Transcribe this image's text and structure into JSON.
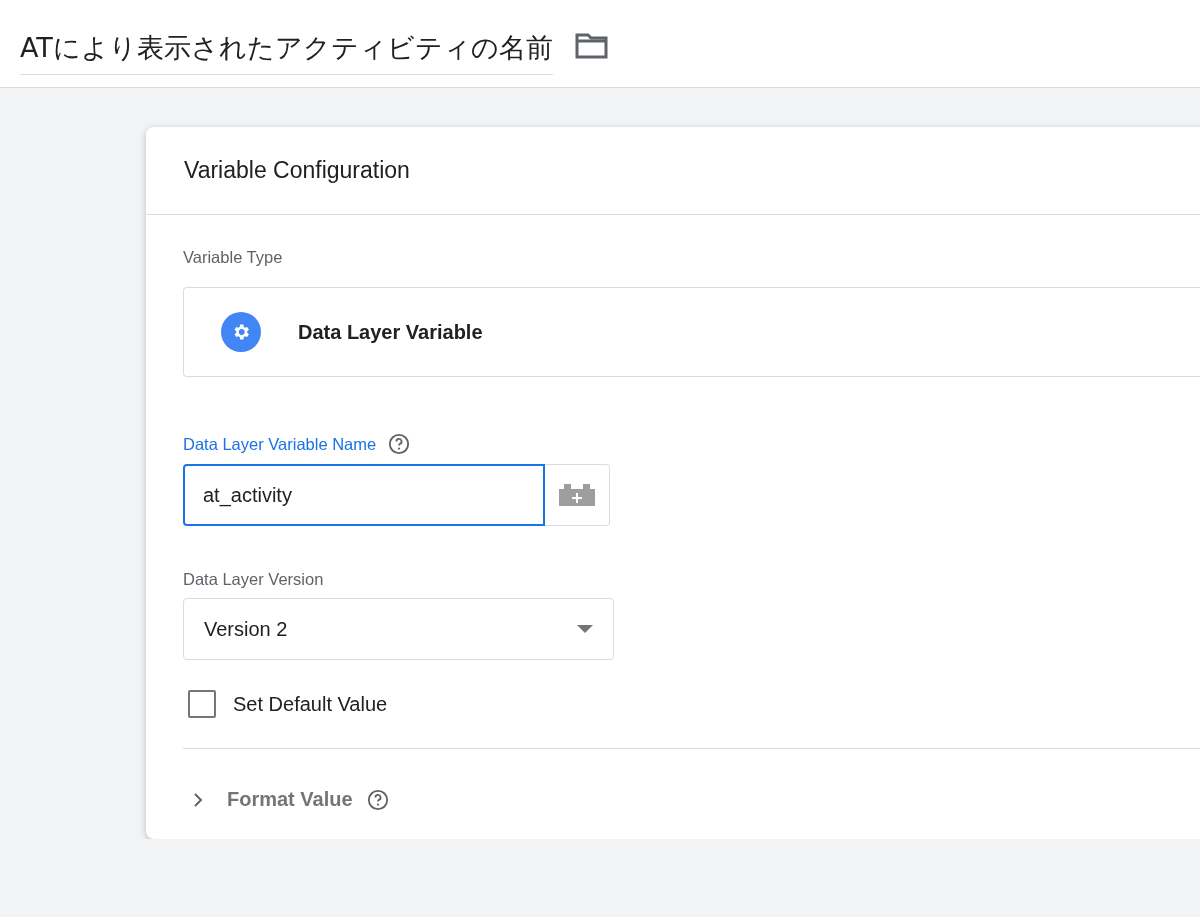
{
  "header": {
    "title": "ATにより表示されたアクティビティの名前"
  },
  "card": {
    "title": "Variable Configuration",
    "variable_type": {
      "label": "Variable Type",
      "name": "Data Layer Variable"
    },
    "name_field": {
      "label": "Data Layer Variable Name",
      "value": "at_activity",
      "focused": true
    },
    "version_select": {
      "label": "Data Layer Version",
      "value": "Version 2"
    },
    "default_checkbox": {
      "label": "Set Default Value",
      "checked": false
    },
    "format_section": {
      "label": "Format Value",
      "expanded": false
    }
  }
}
